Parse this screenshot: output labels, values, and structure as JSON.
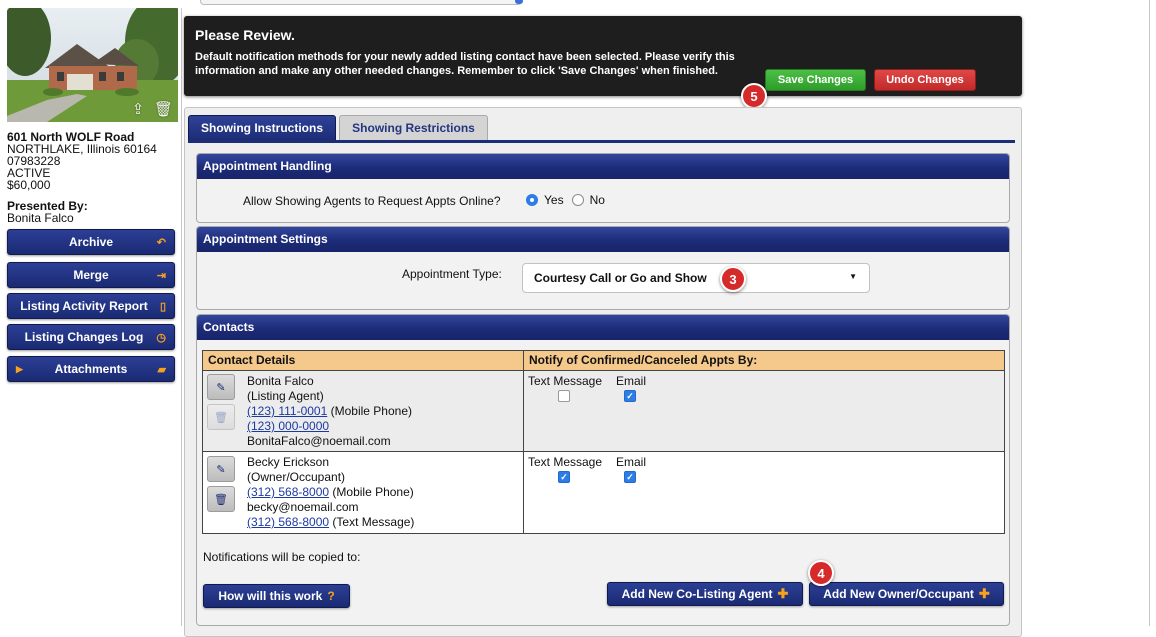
{
  "listing": {
    "address": "601 North WOLF Road",
    "city_line": "NORTHLAKE, Illinois 60164",
    "mls_id": "07983228",
    "status": "ACTIVE",
    "price": "$60,000",
    "presented_by_label": "Presented By:",
    "presented_by": "Bonita Falco"
  },
  "sidebar": {
    "buttons": [
      {
        "label": "Archive",
        "icon": "undo-arrow-icon"
      },
      {
        "label": "Merge",
        "icon": "merge-arrow-icon"
      },
      {
        "label": "Listing Activity Report",
        "icon": "document-icon"
      },
      {
        "label": "Listing Changes Log",
        "icon": "clock-icon"
      },
      {
        "label": "Attachments",
        "icon": "folder-icon"
      }
    ]
  },
  "review": {
    "title": "Please Review.",
    "message": "Default notification methods for your newly added listing contact have been selected. Please verify this information and make any other needed changes. Remember to click 'Save Changes' when finished.",
    "save_label": "Save Changes",
    "undo_label": "Undo Changes"
  },
  "badges": {
    "save": "5",
    "appointment_type": "3",
    "add_owner": "4"
  },
  "tabs": [
    {
      "label": "Showing Instructions",
      "active": true
    },
    {
      "label": "Showing Restrictions",
      "active": false
    }
  ],
  "appointment_handling": {
    "header": "Appointment Handling",
    "question": "Allow Showing Agents to Request Appts Online?",
    "yes_label": "Yes",
    "no_label": "No",
    "selected": "Yes"
  },
  "appointment_settings": {
    "header": "Appointment Settings",
    "type_label": "Appointment Type:",
    "type_value": "Courtesy Call or Go and Show"
  },
  "contacts": {
    "header": "Contacts",
    "col_details": "Contact Details",
    "col_notify": "Notify of Confirmed/Canceled Appts By:",
    "rows": [
      {
        "name": "Bonita Falco",
        "role": "(Listing Agent)",
        "line1_link": "(123) 111-0001",
        "line1_suffix": " (Mobile Phone)",
        "line2_link": "(123) 000-0000",
        "line3": "BonitaFalco@noemail.com",
        "text_label": "Text Message",
        "email_label": "Email",
        "text_checked": false,
        "email_checked": true
      },
      {
        "name": "Becky Erickson",
        "role": "(Owner/Occupant)",
        "line1_link": "(312) 568-8000",
        "line1_suffix": " (Mobile Phone)",
        "line2": "becky@noemail.com",
        "line3_link": "(312) 568-8000",
        "line3_suffix": " (Text Message)",
        "text_label": "Text Message",
        "email_label": "Email",
        "text_checked": true,
        "email_checked": true
      }
    ],
    "copied_to": "Notifications will be copied to:",
    "how_label": "How will this work",
    "add_co_agent_label": "Add New Co-Listing Agent",
    "add_owner_label": "Add New Owner/Occupant"
  },
  "colors": {
    "navy": "#1e2d78",
    "accent_orange": "#f6a21e",
    "save_green": "#2e9d2a",
    "undo_red": "#c22a2a",
    "badge_red": "#d62a2a",
    "table_header": "#f5c98c"
  }
}
